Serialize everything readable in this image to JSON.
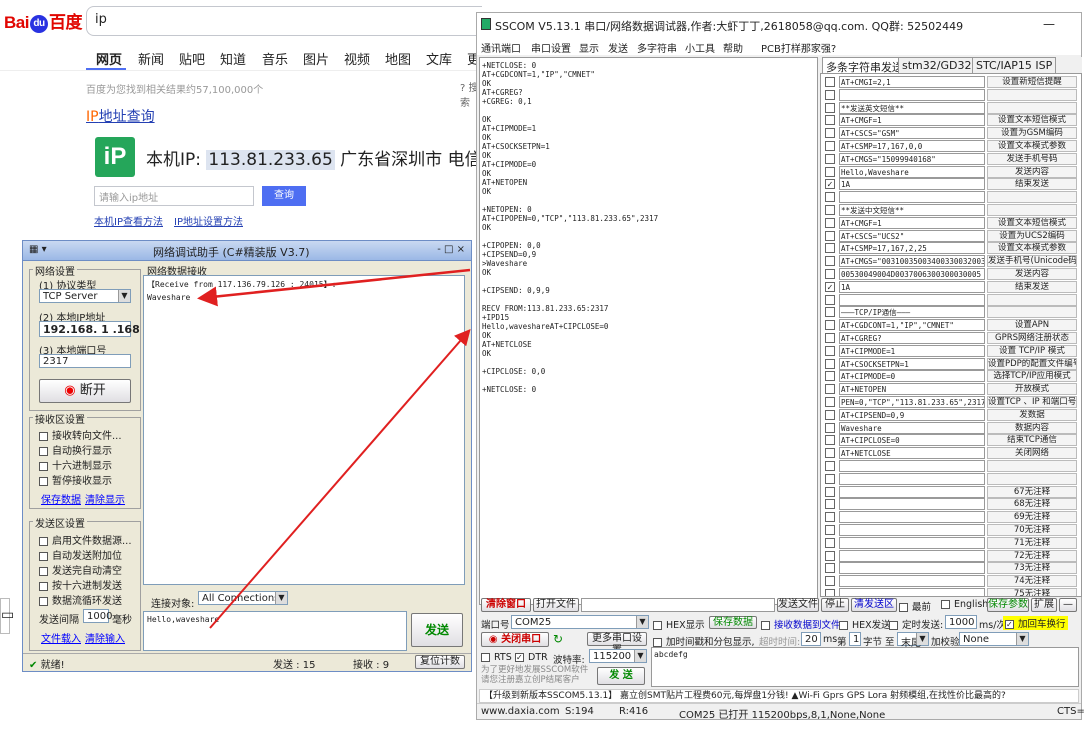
{
  "baidu": {
    "logo_left": "Bai",
    "logo_paw": "du",
    "logo_right": "百度",
    "search_value": "ip",
    "tabs": [
      "网页",
      "新闻",
      "贴吧",
      "知道",
      "音乐",
      "图片",
      "视频",
      "地图",
      "文库",
      "更"
    ],
    "result_count": "百度为您找到相关结果约57,100,000个",
    "search_tools": "搜索",
    "ip_title_prefix": "IP",
    "ip_title_rest": "地址查询",
    "ip_icon": "iP",
    "ip_label": "本机IP: ",
    "ip_value": "113.81.233.65",
    "ip_location": " 广东省深圳市 电信",
    "ip_input_placeholder": "请输入ip地址",
    "ip_query_button": "查询",
    "link1": "本机IP查看方法",
    "link2": "IP地址设置方法"
  },
  "netassist": {
    "title": "网络调试助手 (C#精装版 V3.7)",
    "window_controls": "- □ ×",
    "net_settings": "网络设置",
    "protocol_label": "(1) 协议类型",
    "protocol_value": "TCP Server",
    "local_ip_label": "(2) 本地IP地址",
    "local_ip_value": "192.168. 1 .168",
    "local_port_label": "(3) 本地端口号",
    "local_port_value": "2317",
    "disconnect_button": "断开",
    "recv_settings": "接收区设置",
    "recv_opts": [
      "接收转向文件...",
      "自动换行显示",
      "十六进制显示",
      "暂停接收显示"
    ],
    "save_data": "保存数据",
    "clear_display": "清除显示",
    "send_settings": "发送区设置",
    "send_opts": [
      "启用文件数据源...",
      "自动发送附加位",
      "发送完自动清空",
      "按十六进制发送",
      "数据流循环发送"
    ],
    "send_interval_label": "发送间隔",
    "send_interval_value": "1000",
    "send_interval_unit": "毫秒",
    "file_load": "文件载入",
    "clear_input": "清除输入",
    "recv_area_title": "网络数据接收",
    "recv_line1": "【Receive from 117.136.79.126 : 24015】:",
    "recv_line2": "Waveshare",
    "conn_label": "连接对象:",
    "conn_value": "All Connections",
    "send_text": "Hello,waveshare",
    "send_button": "发送",
    "status_ready": "就绪!",
    "status_send": "发送 : 15",
    "status_recv": "接收 : 9",
    "reset_count": "复位计数"
  },
  "sscom": {
    "title": "SSCOM V5.13.1 串口/网络数据调试器,作者:大虾丁丁,2618058@qq.com. QQ群: 52502449",
    "minimize": "—",
    "menu": [
      "通讯端口",
      "串口设置",
      "显示",
      "发送",
      "多字符串",
      "小工具",
      "帮助",
      "PCB打样那家强?"
    ],
    "output": "+NETCLOSE: 0\nAT+CGDCONT=1,\"IP\",\"CMNET\"\nOK\nAT+CGREG?\n+CGREG: 0,1\n\nOK\nAT+CIPMODE=1\nOK\nAT+CSOCKSETPN=1\nOK\nAT+CIPMODE=0\nOK\nAT+NETOPEN\nOK\n\n+NETOPEN: 0\nAT+CIPOPEN=0,\"TCP\",\"113.81.233.65\",2317\nOK\n\n+CIPOPEN: 0,0\n+CIPSEND=0,9\n>Waveshare\nOK\n\n+CIPSEND: 0,9,9\n\nRECV FROM:113.81.233.65:2317\n+IPD15\nHello,waveshareAT+CIPCLOSE=0\nOK\nAT+NETCLOSE\nOK\n\n+CIPCLOSE: 0,0\n\n+NETCLOSE: 0",
    "tabs": [
      "多条字符串发送",
      "stm32/GD32 ISP",
      "STC/IAP15 ISP"
    ],
    "multi_rows": [
      {
        "chk": "",
        "cmd": "AT+CMGI=2,1",
        "btn": "设置新短信提醒"
      },
      {
        "chk": "",
        "cmd": "",
        "btn": ""
      },
      {
        "chk": "",
        "cmd": "**发送英文短信**",
        "btn": ""
      },
      {
        "chk": "",
        "cmd": "AT+CMGF=1",
        "btn": "设置文本短信模式"
      },
      {
        "chk": "",
        "cmd": "AT+CSCS=\"GSM\"",
        "btn": "设置为GSM编码"
      },
      {
        "chk": "",
        "cmd": "AT+CSMP=17,167,0,0",
        "btn": "设置文本模式参数"
      },
      {
        "chk": "",
        "cmd": "AT+CMGS=\"15099940168\"",
        "btn": "发送手机号码"
      },
      {
        "chk": "",
        "cmd": "Hello,Waveshare",
        "btn": "发送内容"
      },
      {
        "chk": "✓",
        "cmd": "1A",
        "btn": "结束发送"
      },
      {
        "chk": "",
        "cmd": "",
        "btn": ""
      },
      {
        "chk": "",
        "cmd": "**发送中文短信**",
        "btn": ""
      },
      {
        "chk": "",
        "cmd": "AT+CMGF=1",
        "btn": "设置文本短信模式"
      },
      {
        "chk": "",
        "cmd": "AT+CSCS=\"UCS2\"",
        "btn": "设置为UCS2编码"
      },
      {
        "chk": "",
        "cmd": "AT+CSMP=17,167,2,25",
        "btn": "设置文本模式参数"
      },
      {
        "chk": "",
        "cmd": "AT+CMGS=\"00310035003400330032003",
        "btn": "发送手机号(Unicode码"
      },
      {
        "chk": "",
        "cmd": "00530049004D0037006300300030005",
        "btn": "发送内容"
      },
      {
        "chk": "✓",
        "cmd": "1A",
        "btn": "结束发送"
      },
      {
        "chk": "",
        "cmd": "",
        "btn": ""
      },
      {
        "chk": "",
        "cmd": "———TCP/IP通信———",
        "btn": ""
      },
      {
        "chk": "",
        "cmd": "AT+CGDCONT=1,\"IP\",\"CMNET\"",
        "btn": "设置APN"
      },
      {
        "chk": "",
        "cmd": "AT+CGREG?",
        "btn": "GPRS网络注册状态"
      },
      {
        "chk": "",
        "cmd": "AT+CIPMODE=1",
        "btn": "设置 TCP/IP 模式"
      },
      {
        "chk": "",
        "cmd": "AT+CSOCKSETPN=1",
        "btn": "设置PDP的配置文件编号"
      },
      {
        "chk": "",
        "cmd": "AT+CIPMODE=0",
        "btn": "选择TCP/IP应用模式"
      },
      {
        "chk": "",
        "cmd": "AT+NETOPEN",
        "btn": "开放模式"
      },
      {
        "chk": "",
        "cmd": "PEN=0,\"TCP\",\"113.81.233.65\",2317",
        "btn": "设置TCP 、IP 和端口号"
      },
      {
        "chk": "",
        "cmd": "AT+CIPSEND=0,9",
        "btn": "发数据"
      },
      {
        "chk": "",
        "cmd": "Waveshare",
        "btn": "数据内容"
      },
      {
        "chk": "",
        "cmd": "AT+CIPCLOSE=0",
        "btn": "结束TCP通信"
      },
      {
        "chk": "",
        "cmd": "AT+NETCLOSE",
        "btn": "关闭网络"
      },
      {
        "chk": "",
        "cmd": "",
        "btn": ""
      },
      {
        "chk": "",
        "cmd": "",
        "btn": ""
      },
      {
        "chk": "",
        "cmd": "",
        "btn": "67无注释"
      },
      {
        "chk": "",
        "cmd": "",
        "btn": "68无注释"
      },
      {
        "chk": "",
        "cmd": "",
        "btn": "69无注释"
      },
      {
        "chk": "",
        "cmd": "",
        "btn": "70无注释"
      },
      {
        "chk": "",
        "cmd": "",
        "btn": "71无注释"
      },
      {
        "chk": "",
        "cmd": "",
        "btn": "72无注释"
      },
      {
        "chk": "",
        "cmd": "",
        "btn": "73无注释"
      },
      {
        "chk": "",
        "cmd": "",
        "btn": "74无注释"
      },
      {
        "chk": "",
        "cmd": "",
        "btn": "75无注释"
      }
    ],
    "clear_window": "清除窗口",
    "open_file": "打开文件",
    "send_file": "发送文件",
    "stop": "停止",
    "clear_send": "清发送区",
    "top_most": "最前",
    "english": "English",
    "save_params": "保存参数",
    "expand": "扩展",
    "dash": "—",
    "port_label": "端口号",
    "port_value": "COM25",
    "hex_display": "HEX显示",
    "save_data": "保存数据",
    "recv_to_file": "接收数据到文件",
    "hex_send": "HEX发送",
    "timed_send": "定时发送:",
    "timed_value": "1000",
    "timed_unit": "ms/次",
    "add_crlf": "加回车换行",
    "close_port": "关闭串口",
    "more_ports": "更多串口设置",
    "timestamp": "加时间戳和分包显示,",
    "timeout_label": "超时时间:",
    "timeout_value": "20",
    "ms": "ms",
    "page_label": "第",
    "page_value": "1",
    "byte_label": "字节 至",
    "end_value": "末尾",
    "checksum_label": "加校验",
    "checksum_value": "None",
    "rts": "RTS",
    "dtr": "DTR",
    "baud_label": "波特率:",
    "baud_value": "115200",
    "send_input": "abcdefg",
    "promo": "为了更好地发展SSCOM软件\n请您注册嘉立创P结尾客户",
    "send_button": "发 送",
    "ticker": "【升级到新版本SSCOM5.13.1】 嘉立创SMT贴片工程费60元,每焊盘1分钱! ▲Wi-Fi Gprs GPS Lora 射频模组,在找性价比最高的?",
    "status": {
      "site": "www.daxia.com",
      "s": "S:194",
      "r": "R:416",
      "port": "COM25 已打开  115200bps,8,1,None,None",
      "cts": "CTS="
    }
  },
  "desktop": {
    "note_icon": "▭"
  }
}
